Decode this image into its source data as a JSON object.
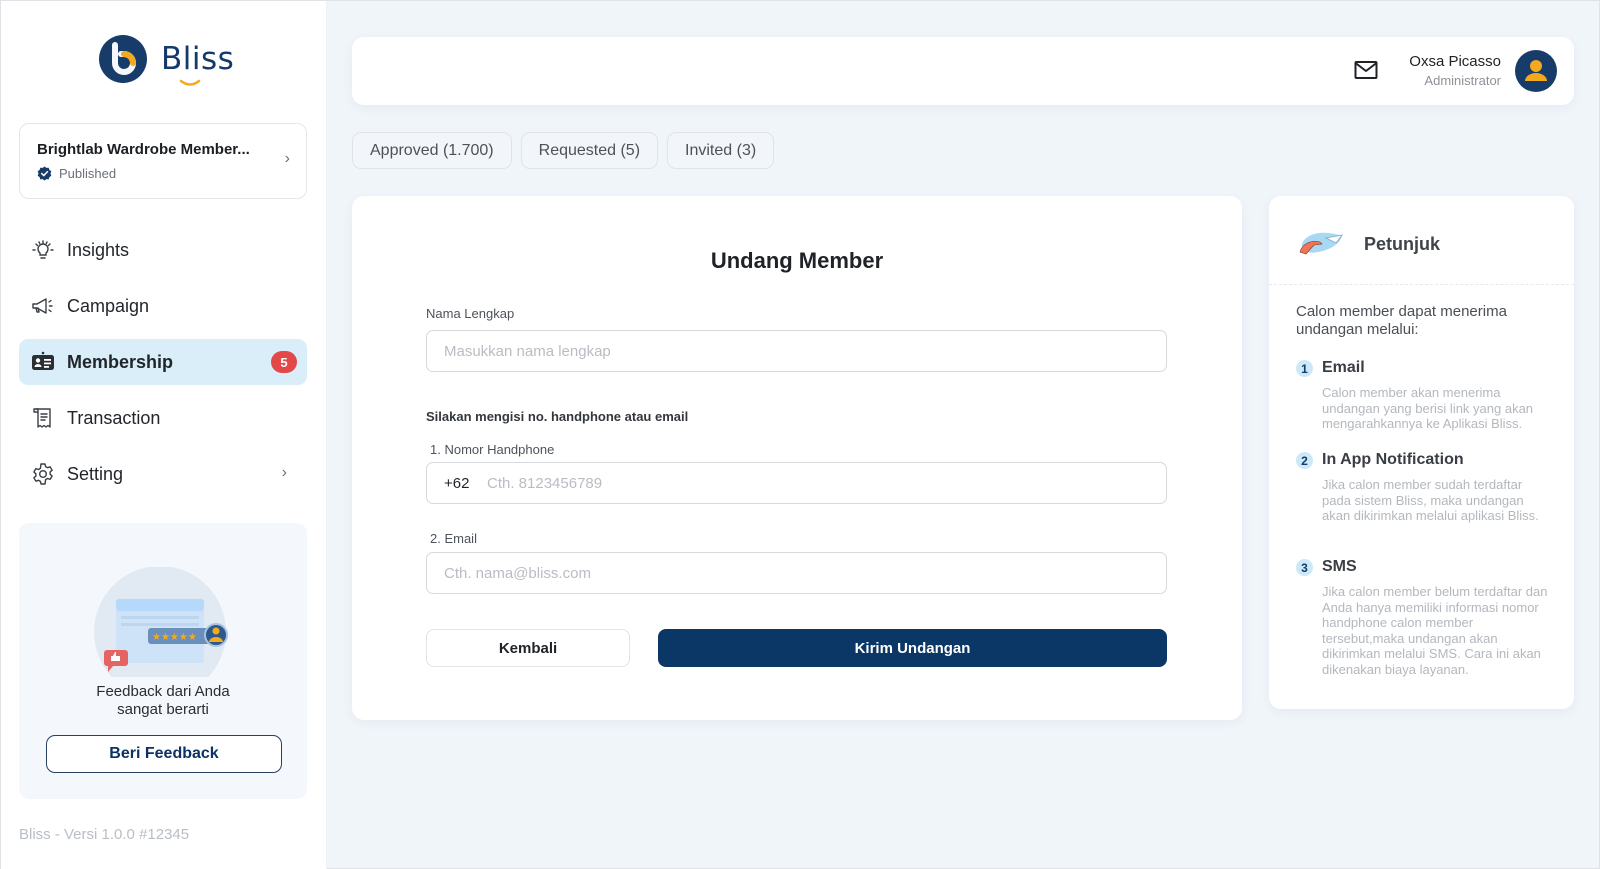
{
  "app": {
    "logo_text": "Bliss",
    "brand_color": "#133a6a",
    "accent_color": "#f4a91f"
  },
  "sidebar": {
    "program": {
      "title": "Brightlab Wardrobe Member...",
      "status": "Published"
    },
    "nav": [
      {
        "label": "Insights",
        "icon": "lightbulb-icon"
      },
      {
        "label": "Campaign",
        "icon": "megaphone-icon"
      },
      {
        "label": "Membership",
        "icon": "id-card-icon",
        "active": true,
        "badge": "5"
      },
      {
        "label": "Transaction",
        "icon": "receipt-icon"
      },
      {
        "label": "Setting",
        "icon": "gear-icon",
        "has_submenu": true
      }
    ],
    "feedback": {
      "text_line1": "Feedback dari Anda",
      "text_line2": "sangat berarti",
      "button_label": "Beri Feedback"
    },
    "version": "Bliss - Versi 1.0.0 #12345"
  },
  "header": {
    "user_name": "Oxsa Picasso",
    "user_role": "Administrator"
  },
  "tabs": [
    {
      "label": "Approved (1.700)"
    },
    {
      "label": "Requested (5)"
    },
    {
      "label": "Invited (3)"
    }
  ],
  "form": {
    "title": "Undang Member",
    "name_label": "Nama Lengkap",
    "name_placeholder": "Masukkan nama lengkap",
    "name_value": "",
    "contact_instruction": "Silakan mengisi no. handphone atau email",
    "phone_label": "1. Nomor Handphone",
    "phone_prefix": "+62",
    "phone_placeholder": "Cth. 8123456789",
    "phone_value": "",
    "email_label": "2. Email",
    "email_placeholder": "Cth. nama@bliss.com",
    "email_value": "",
    "back_label": "Kembali",
    "submit_label": "Kirim Undangan"
  },
  "guide": {
    "title": "Petunjuk",
    "intro": "Calon member dapat menerima undangan melalui:",
    "items": [
      {
        "num": "1",
        "title": "Email",
        "desc": "Calon member akan menerima undangan yang berisi link yang akan mengarahkannya ke Aplikasi Bliss."
      },
      {
        "num": "2",
        "title": "In App Notification",
        "desc": "Jika calon member sudah terdaftar pada sistem Bliss, maka undangan akan dikirimkan melalui aplikasi Bliss."
      },
      {
        "num": "3",
        "title": "SMS",
        "desc": "Jika calon member belum terdaftar dan Anda hanya memiliki informasi nomor handphone calon member tersebut,maka undangan akan dikirimkan melalui SMS. Cara ini akan dikenakan biaya layanan."
      }
    ]
  }
}
